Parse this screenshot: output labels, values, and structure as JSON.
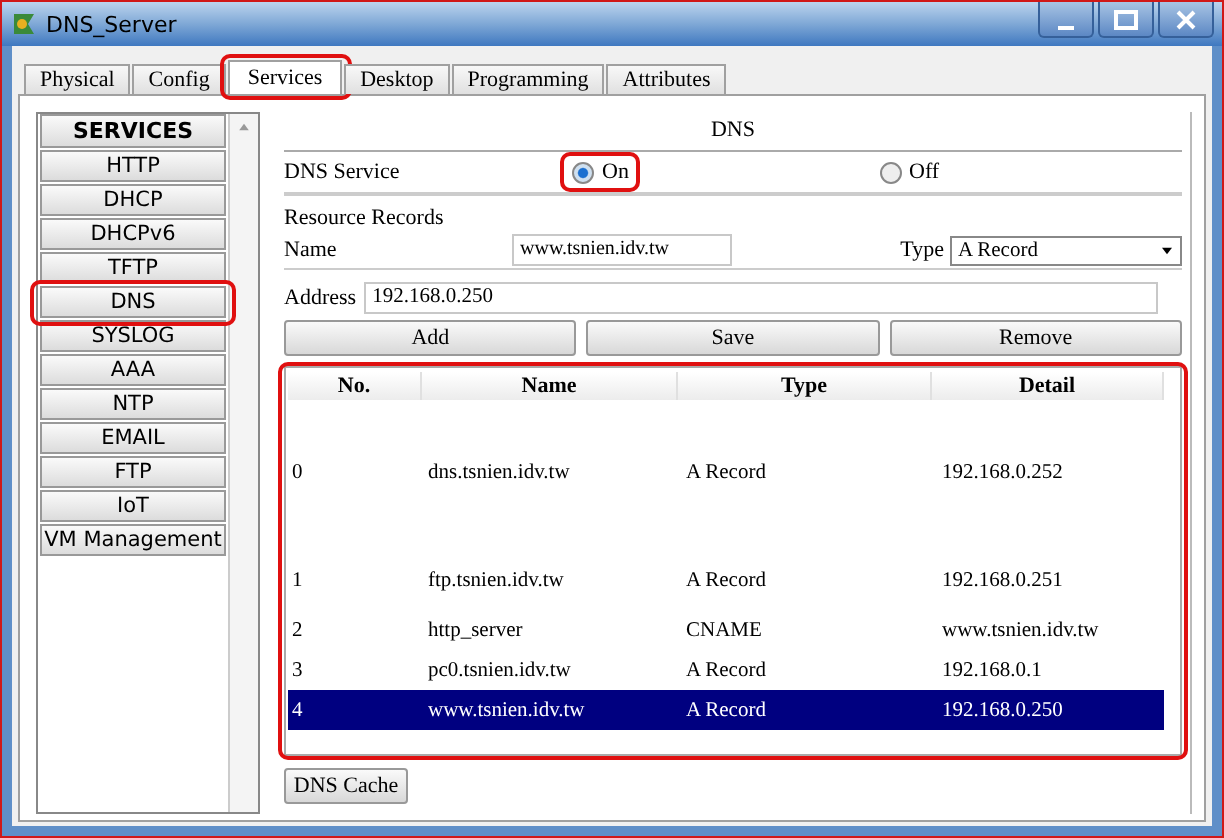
{
  "window": {
    "title": "DNS_Server"
  },
  "tabs": [
    {
      "label": "Physical",
      "selected": false,
      "highlighted": false
    },
    {
      "label": "Config",
      "selected": false,
      "highlighted": false
    },
    {
      "label": "Services",
      "selected": true,
      "highlighted": true
    },
    {
      "label": "Desktop",
      "selected": false,
      "highlighted": false
    },
    {
      "label": "Programming",
      "selected": false,
      "highlighted": false
    },
    {
      "label": "Attributes",
      "selected": false,
      "highlighted": false
    }
  ],
  "sidebar": {
    "header": "SERVICES",
    "items": [
      {
        "label": "HTTP",
        "highlighted": false
      },
      {
        "label": "DHCP",
        "highlighted": false
      },
      {
        "label": "DHCPv6",
        "highlighted": false
      },
      {
        "label": "TFTP",
        "highlighted": false
      },
      {
        "label": "DNS",
        "highlighted": true
      },
      {
        "label": "SYSLOG",
        "highlighted": false
      },
      {
        "label": "AAA",
        "highlighted": false
      },
      {
        "label": "NTP",
        "highlighted": false
      },
      {
        "label": "EMAIL",
        "highlighted": false
      },
      {
        "label": "FTP",
        "highlighted": false
      },
      {
        "label": "IoT",
        "highlighted": false
      },
      {
        "label": "VM Management",
        "highlighted": false
      }
    ]
  },
  "panel": {
    "title": "DNS",
    "service_label": "DNS Service",
    "service_options": [
      {
        "label": "On",
        "selected": true,
        "highlighted": true
      },
      {
        "label": "Off",
        "selected": false,
        "highlighted": false
      }
    ],
    "records_label": "Resource Records",
    "name_label": "Name",
    "name_value": "www.tsnien.idv.tw",
    "type_label": "Type",
    "type_value": "A Record",
    "address_label": "Address",
    "address_value": "192.168.0.250",
    "buttons": [
      "Add",
      "Save",
      "Remove"
    ],
    "table": {
      "highlighted": true,
      "columns": [
        "No.",
        "Name",
        "Type",
        "Detail"
      ],
      "rows": [
        {
          "cells": [
            "0",
            "dns.tsnien.idv.tw",
            "A Record",
            "192.168.0.252"
          ],
          "selected": false
        },
        {
          "cells": [
            "1",
            "ftp.tsnien.idv.tw",
            "A Record",
            "192.168.0.251"
          ],
          "selected": false
        },
        {
          "cells": [
            "2",
            "http_server",
            "CNAME",
            "www.tsnien.idv.tw"
          ],
          "selected": false
        },
        {
          "cells": [
            "3",
            "pc0.tsnien.idv.tw",
            "A Record",
            "192.168.0.1"
          ],
          "selected": false
        },
        {
          "cells": [
            "4",
            "www.tsnien.idv.tw",
            "A Record",
            "192.168.0.250"
          ],
          "selected": true
        }
      ]
    },
    "cache_button": "DNS Cache"
  }
}
